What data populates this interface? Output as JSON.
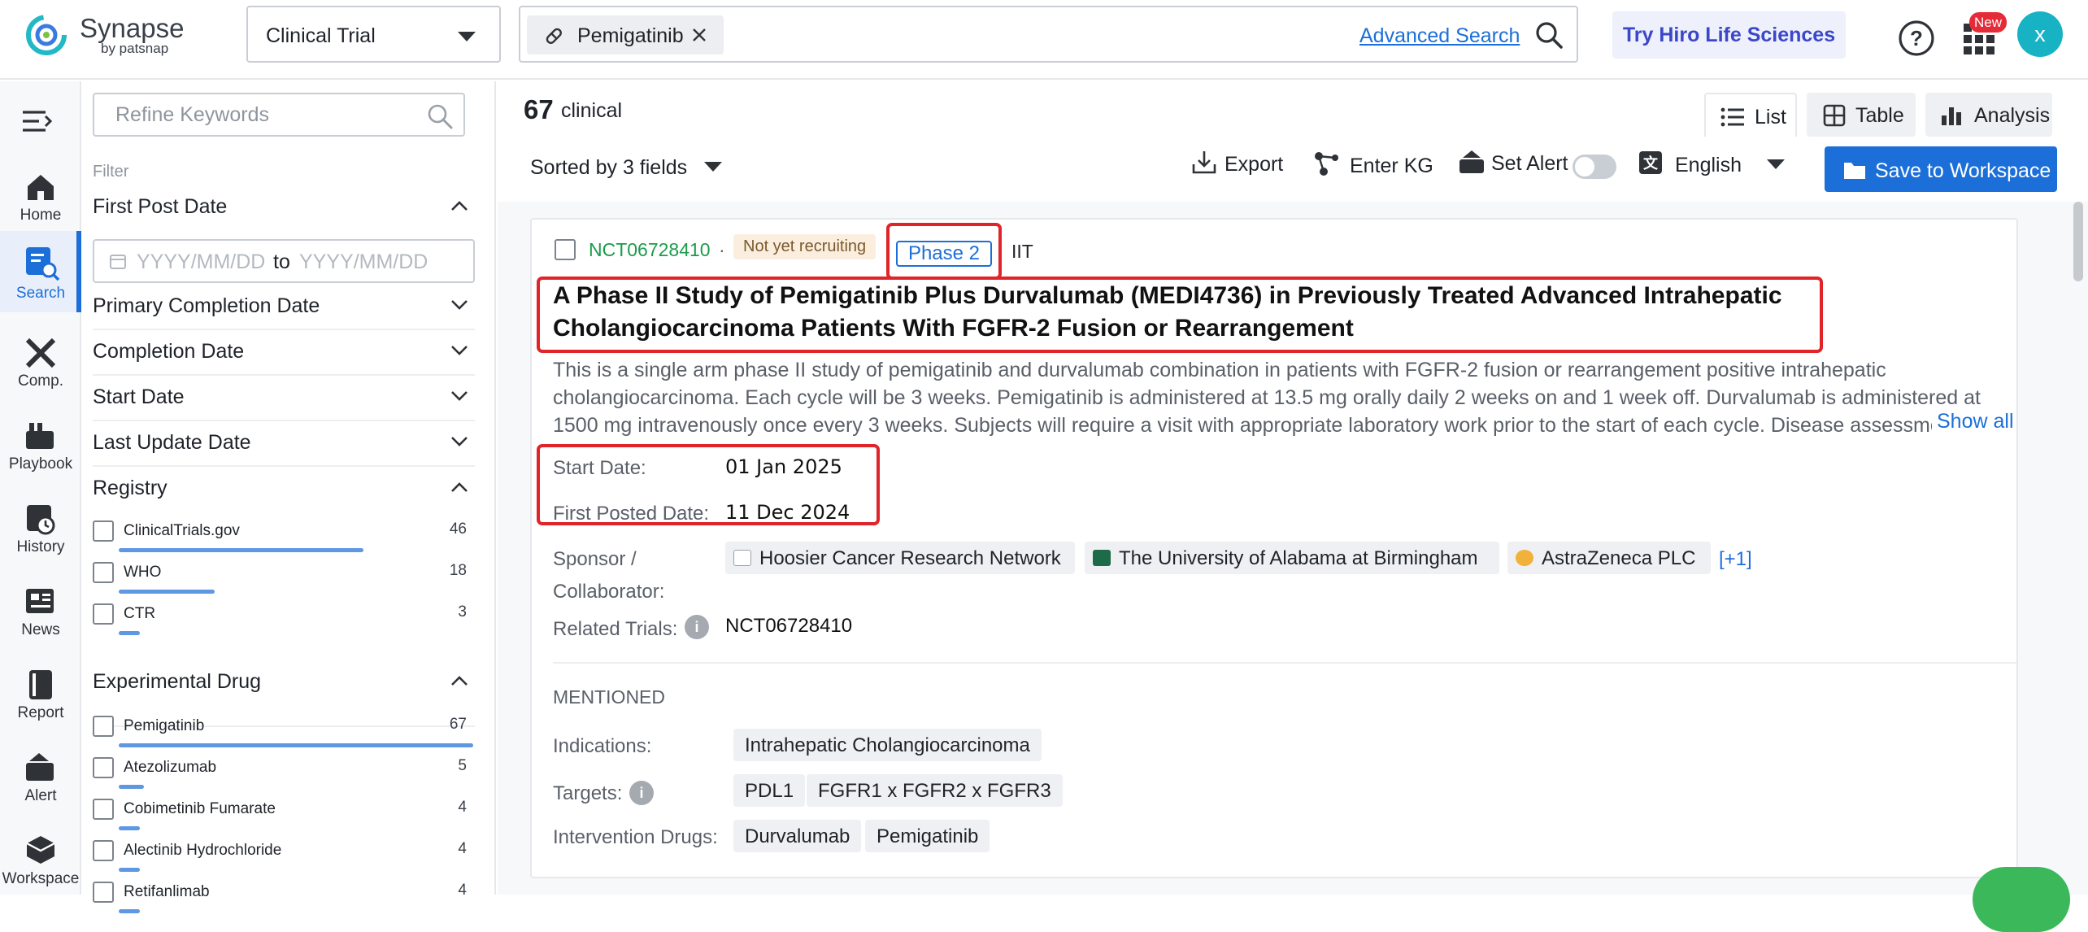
{
  "header": {
    "logo_text": "Synapse",
    "logo_sub": "by patsnap",
    "database_select": "Clinical Trial",
    "search_chip": "Pemigatinib",
    "advanced_search": "Advanced Search",
    "hiro_button": "Try Hiro Life Sciences",
    "new_badge": "New",
    "avatar_initial": "x",
    "colors": {
      "brand": "#1c6fd8",
      "avatar": "#17b3c4",
      "badge": "#e52b38"
    }
  },
  "leftnav": {
    "items": [
      {
        "label": "Home",
        "icon": "home-icon"
      },
      {
        "label": "Search",
        "icon": "search-doc-icon"
      },
      {
        "label": "Comp.",
        "icon": "compare-icon"
      },
      {
        "label": "Playbook",
        "icon": "playbook-icon"
      },
      {
        "label": "History",
        "icon": "history-icon"
      },
      {
        "label": "News",
        "icon": "news-icon"
      },
      {
        "label": "Report",
        "icon": "report-icon"
      },
      {
        "label": "Alert",
        "icon": "alert-icon"
      },
      {
        "label": "Workspace",
        "icon": "workspace-icon"
      }
    ],
    "active": "Search"
  },
  "filter": {
    "refine_placeholder": "Refine Keywords",
    "filter_label": "Filter",
    "sections": {
      "first_post_date": "First Post Date",
      "primary_completion_date": "Primary Completion Date",
      "completion_date": "Completion Date",
      "start_date": "Start Date",
      "last_update_date": "Last Update Date",
      "registry": "Registry",
      "experimental_drug": "Experimental Drug"
    },
    "date_from_placeholder": "YYYY/MM/DD",
    "date_to_word": "to",
    "date_to_placeholder": "YYYY/MM/DD",
    "registry_items": [
      {
        "name": "ClinicalTrials.gov",
        "count": "46",
        "fill": 0.69
      },
      {
        "name": "WHO",
        "count": "18",
        "fill": 0.27
      },
      {
        "name": "CTR",
        "count": "3",
        "fill": 0.04
      }
    ],
    "drug_items": [
      {
        "name": "Pemigatinib",
        "count": "67",
        "fill": 1.0
      },
      {
        "name": "Atezolizumab",
        "count": "5",
        "fill": 0.07
      },
      {
        "name": "Cobimetinib Fumarate",
        "count": "4",
        "fill": 0.06
      },
      {
        "name": "Alectinib Hydrochloride",
        "count": "4",
        "fill": 0.06
      },
      {
        "name": "Retifanlimab",
        "count": "4",
        "fill": 0.06
      }
    ]
  },
  "main": {
    "result_count": "67",
    "result_word": "clinical",
    "views": {
      "list": "List",
      "table": "Table",
      "analysis": "Analysis"
    },
    "sort_label": "Sorted by 3 fields",
    "export": "Export",
    "enter_kg": "Enter KG",
    "set_alert": "Set Alert",
    "language": "English",
    "save_workspace": "Save to Workspace",
    "card": {
      "nct_id": "NCT06728410",
      "separator": "·",
      "status": "Not yet recruiting",
      "phase": "Phase 2",
      "type": "IIT",
      "title": "A Phase II Study of Pemigatinib Plus Durvalumab (MEDI4736) in Previously Treated Advanced Intrahepatic Cholangiocarcinoma Patients With FGFR-2 Fusion or Rearrangement",
      "description": "This is a single arm phase II study of pemigatinib and durvalumab combination in patients with FGFR-2 fusion or rearrangement positive intrahepatic cholangiocarcinoma. Each cycle will be 3 weeks. Pemigatinib is administered at 13.5 mg orally daily 2 weeks on and 1 week off. Durvalumab is administered at 1500 mg intravenously once every 3 weeks. Subjects will require a visit with appropriate laboratory work prior to the start of each cycle. Disease assessment will occur",
      "show_all": "Show all",
      "start_date_label": "Start Date:",
      "start_date": "01 Jan 2025",
      "first_posted_label": "First Posted Date:",
      "first_posted": "11 Dec 2024",
      "sponsor_label_1": "Sponsor /",
      "sponsor_label_2": "Collaborator:",
      "sponsors": [
        "Hoosier Cancer Research Network",
        "The University of Alabama at Birmingham",
        "AstraZeneca PLC"
      ],
      "more_sponsors": "[+1]",
      "related_label": "Related Trials:",
      "related_value": "NCT06728410",
      "mentioned": "MENTIONED",
      "indications_label": "Indications:",
      "indications": [
        "Intrahepatic Cholangiocarcinoma"
      ],
      "targets_label": "Targets:",
      "targets": [
        "PDL1",
        "FGFR1 x FGFR2 x FGFR3"
      ],
      "drugs_label": "Intervention Drugs:",
      "drugs": [
        "Durvalumab",
        "Pemigatinib"
      ]
    }
  }
}
